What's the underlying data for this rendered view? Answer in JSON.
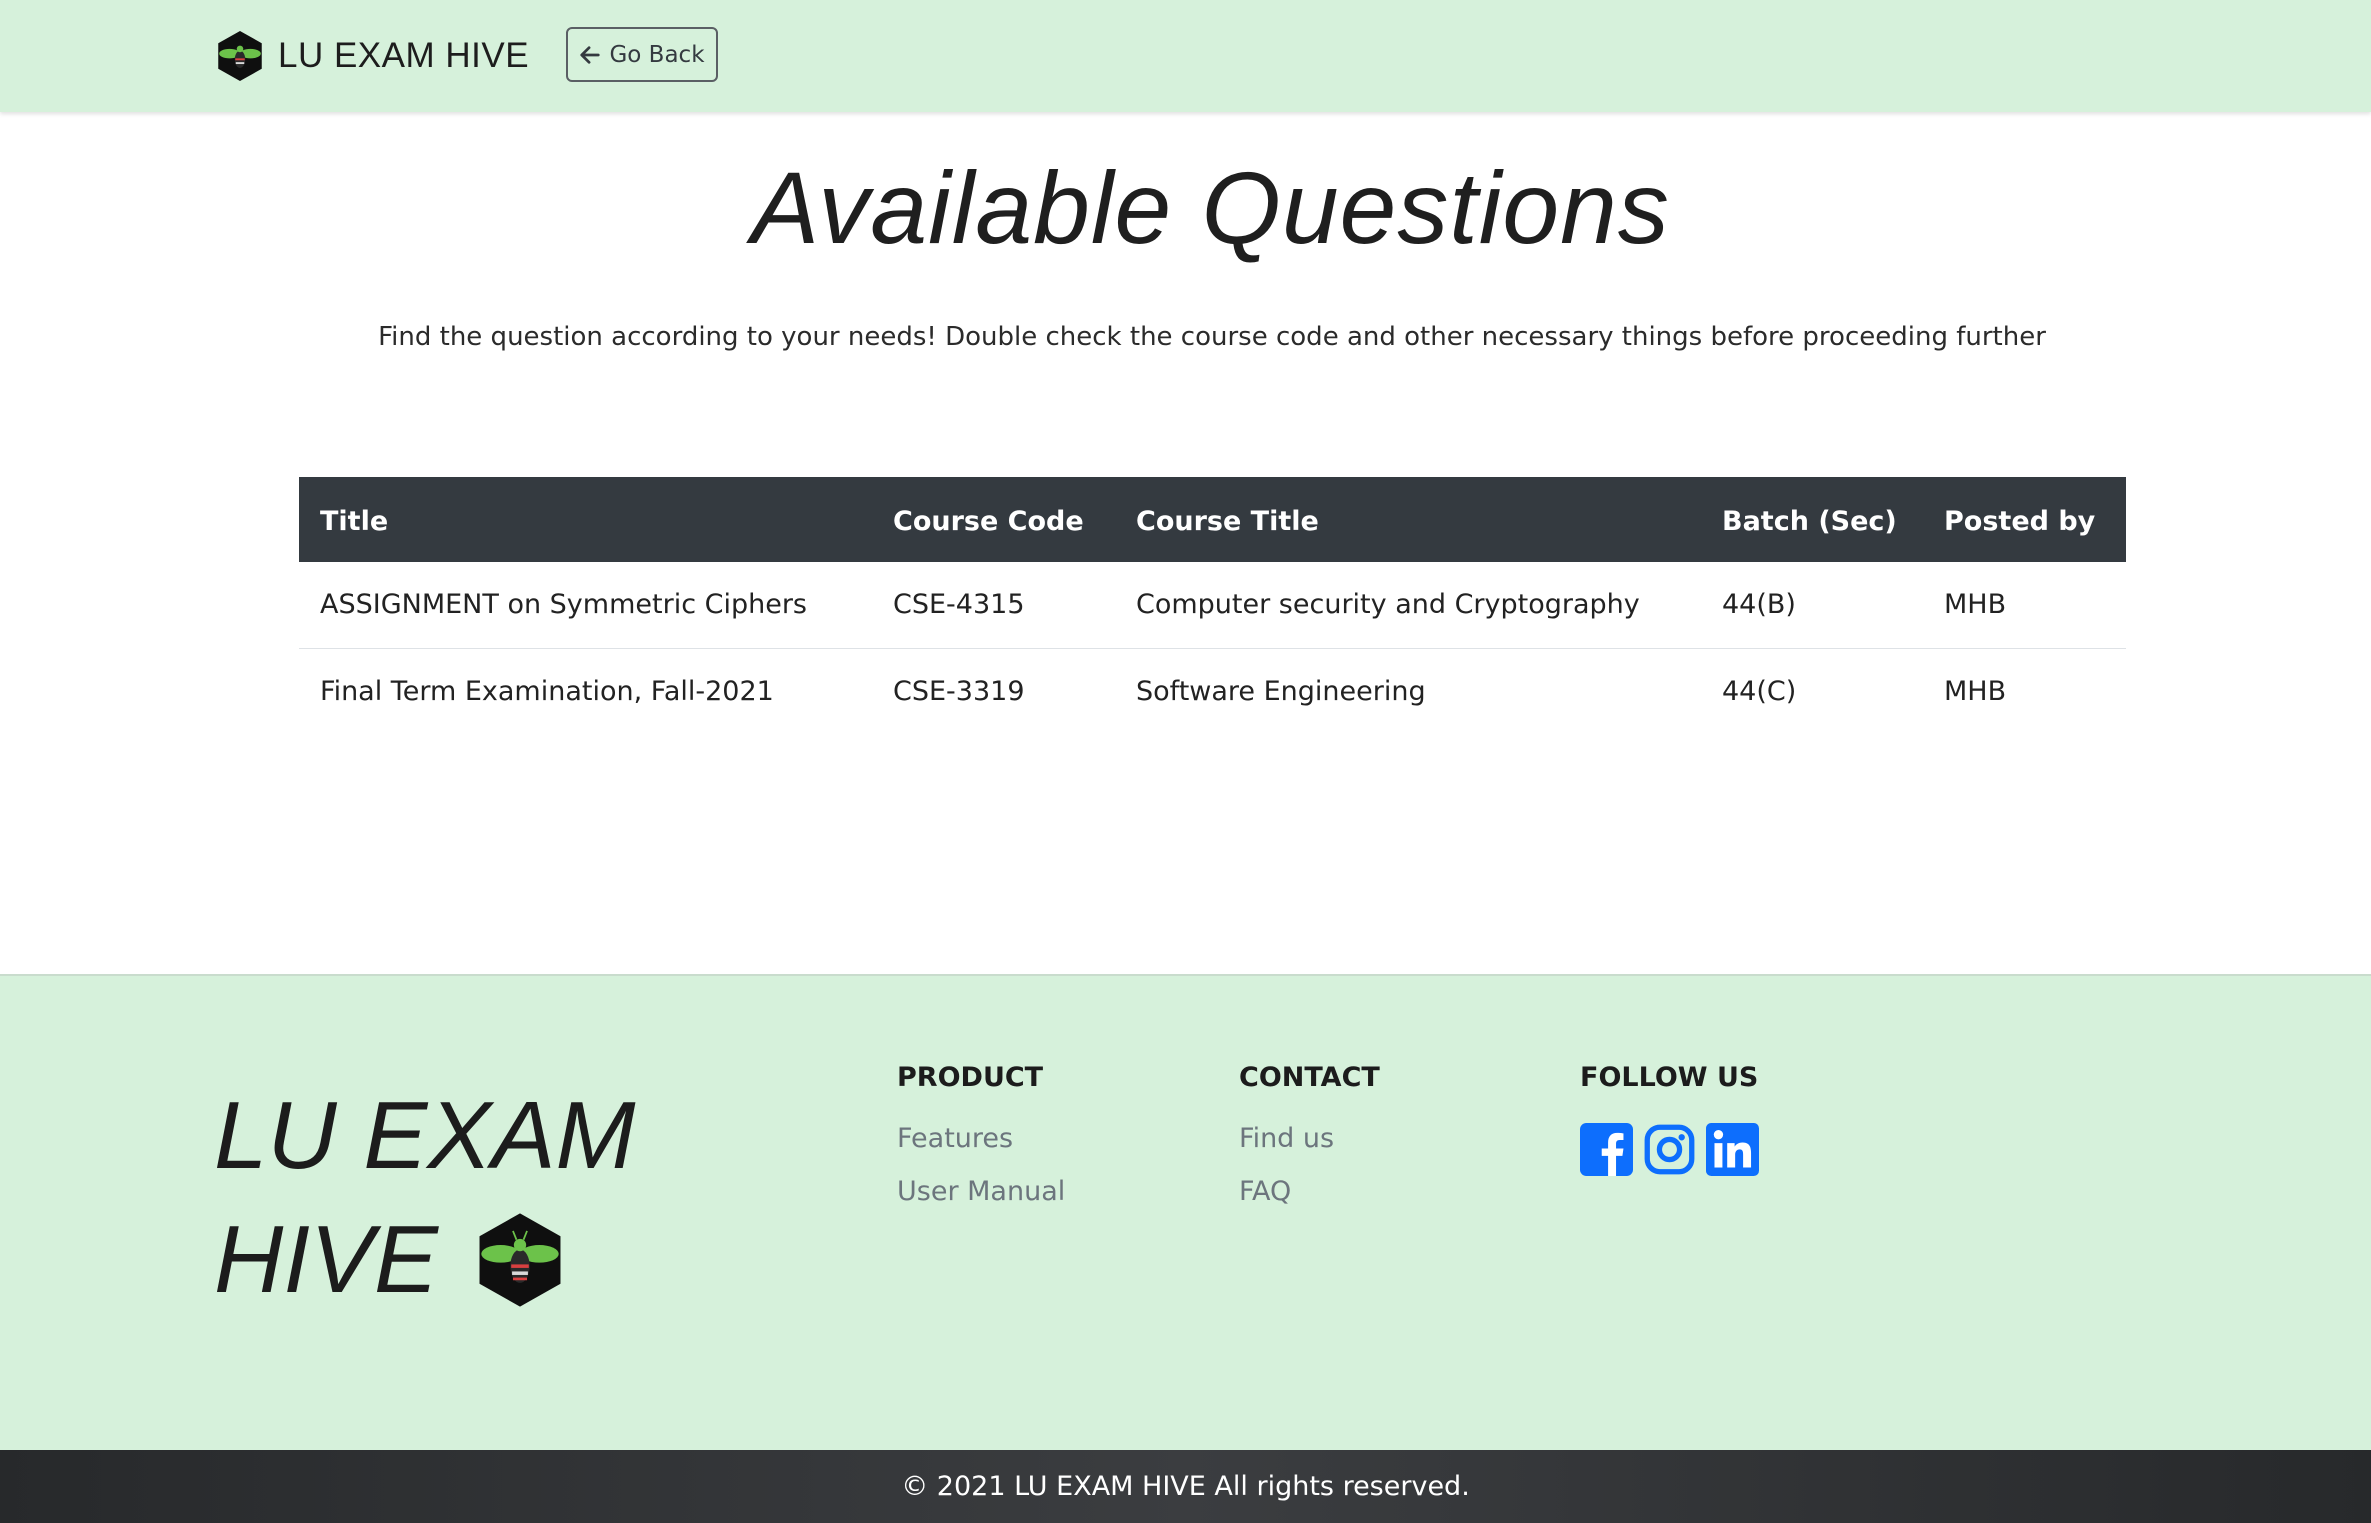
{
  "navbar": {
    "brand": "LU EXAM HIVE",
    "go_back_label": "Go Back"
  },
  "page": {
    "title": "Available Questions",
    "subtitle": "Find the question according to your needs! Double check the course code and other necessary things before proceeding further"
  },
  "table": {
    "headers": [
      "Title",
      "Course Code",
      "Course Title",
      "Batch (Sec)",
      "Posted by"
    ],
    "rows": [
      [
        "ASSIGNMENT on Symmetric Ciphers",
        "CSE-4315",
        "Computer security and Cryptography",
        "44(B)",
        "MHB"
      ],
      [
        "Final Term Examination, Fall-2021",
        "CSE-3319",
        "Software Engineering",
        "44(C)",
        "MHB"
      ]
    ]
  },
  "footer": {
    "brand_line1": "LU EXAM",
    "brand_line2": "HIVE",
    "product": {
      "heading": "PRODUCT",
      "links": [
        "Features",
        "User Manual"
      ]
    },
    "contact": {
      "heading": "CONTACT",
      "links": [
        "Find us",
        "FAQ"
      ]
    },
    "follow": {
      "heading": "FOLLOW US",
      "icons": [
        "facebook-icon",
        "instagram-icon",
        "linkedin-icon"
      ]
    },
    "copyright": "© 2021 LU EXAM HIVE All rights reserved."
  },
  "colors": {
    "nav_bg": "#d6f1db",
    "table_header_bg": "#343a40",
    "social_blue": "#0d6efd",
    "bee_green": "#6cc24a"
  }
}
